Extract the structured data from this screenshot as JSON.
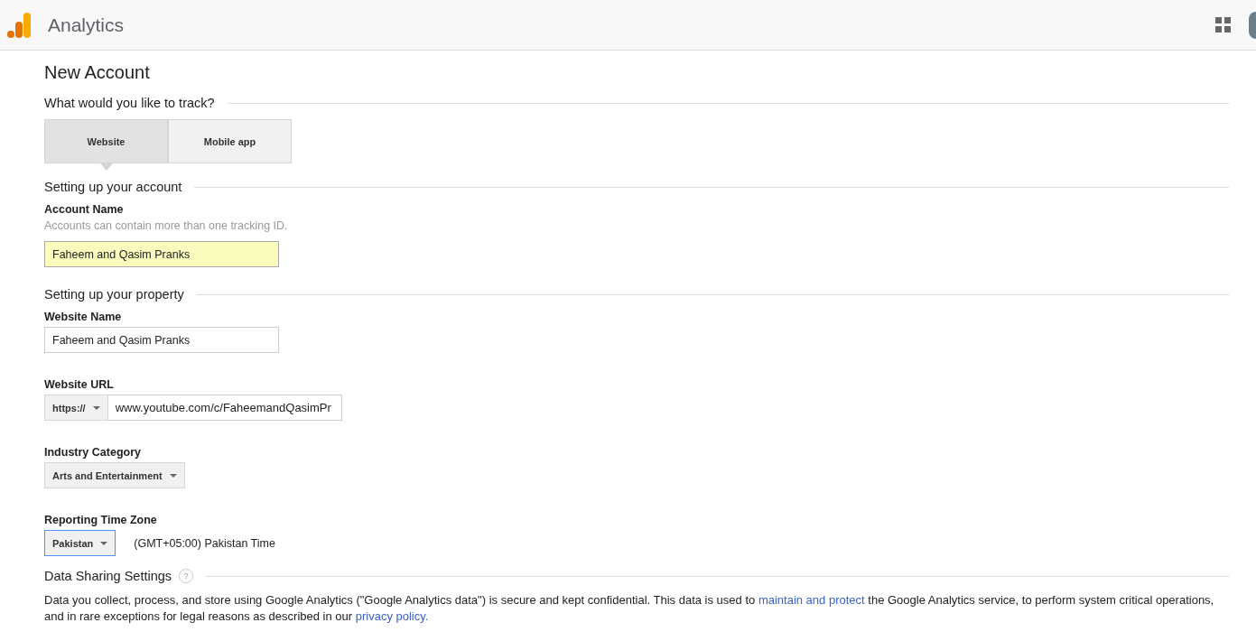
{
  "header": {
    "product": "Analytics"
  },
  "page_title": "New Account",
  "track": {
    "heading": "What would you like to track?",
    "options": [
      {
        "label": "Website",
        "selected": true
      },
      {
        "label": "Mobile app",
        "selected": false
      }
    ]
  },
  "account": {
    "heading": "Setting up your account",
    "label": "Account Name",
    "hint": "Accounts can contain more than one tracking ID.",
    "value": "Faheem and Qasim Pranks",
    "highlighted": true
  },
  "property": {
    "heading": "Setting up your property",
    "website_name": {
      "label": "Website Name",
      "value": "Faheem and Qasim Pranks",
      "highlighted": false
    },
    "website_url": {
      "label": "Website URL",
      "protocol": "https://",
      "value": "www.youtube.com/c/FaheemandQasimPr"
    },
    "industry": {
      "label": "Industry Category",
      "value": "Arts and Entertainment",
      "focused": false
    },
    "time_zone": {
      "label": "Reporting Time Zone",
      "value": "Pakistan",
      "focused": true,
      "description": "(GMT+05:00) Pakistan Time"
    }
  },
  "data_sharing": {
    "heading": "Data Sharing Settings",
    "help": "?",
    "paragraph": [
      {
        "kind": "text",
        "text": "Data you collect, process, and store using Google Analytics (\"Google Analytics data\") is secure and kept confidential. This data is used to "
      },
      {
        "kind": "link",
        "text": "maintain and protect"
      },
      {
        "kind": "text",
        "text": " the Google Analytics service, to perform system critical operations, and in rare exceptions for legal reasons as described in our "
      },
      {
        "kind": "link",
        "text": "privacy policy."
      }
    ]
  }
}
